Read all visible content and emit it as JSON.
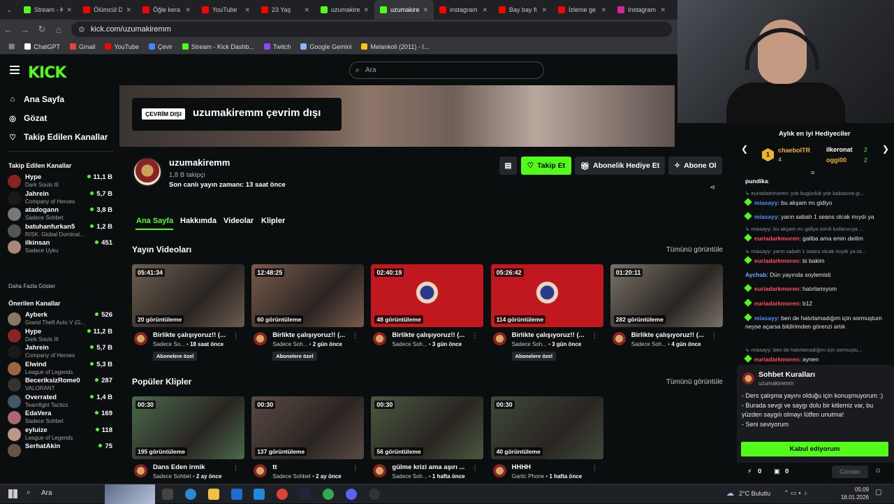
{
  "browser": {
    "tabs": [
      {
        "title": "Stream - K",
        "color": "#53fc18"
      },
      {
        "title": "Ölümcül D",
        "color": "#ff0000"
      },
      {
        "title": "Öğle kera",
        "color": "#ff0000"
      },
      {
        "title": "YouTube",
        "color": "#ff0000"
      },
      {
        "title": "23 Yaş",
        "color": "#ff0000"
      },
      {
        "title": "uzumakire",
        "color": "#53fc18"
      },
      {
        "title": "uzumakire",
        "color": "#53fc18"
      },
      {
        "title": "instagram",
        "color": "#ff0000"
      },
      {
        "title": "Bay bay fi",
        "color": "#ff0000"
      },
      {
        "title": "İzleme ge",
        "color": "#ff0000"
      },
      {
        "title": "Instagram",
        "color": "#d6249f"
      }
    ],
    "url": "kick.com/uzumakiremm",
    "bookmarks": [
      {
        "label": "ChatGPT",
        "color": "#ffffff"
      },
      {
        "label": "Gmail",
        "color": "#ea4335"
      },
      {
        "label": "YouTube",
        "color": "#ff0000"
      },
      {
        "label": "Çevir",
        "color": "#4285f4"
      },
      {
        "label": "Stream - Kick Dashb...",
        "color": "#53fc18"
      },
      {
        "label": "Twitch",
        "color": "#9146ff"
      },
      {
        "label": "Google Gemini",
        "color": "#8ab4f8"
      },
      {
        "label": "Melankoli (2011) - I...",
        "color": "#f5c518"
      }
    ]
  },
  "header": {
    "logo": "KICK",
    "search_placeholder": "Ara"
  },
  "sidebar": {
    "nav": [
      {
        "label": "Ana Sayfa",
        "icon": "home-icon"
      },
      {
        "label": "Gözat",
        "icon": "compass-icon"
      },
      {
        "label": "Takip Edilen Kanallar",
        "icon": "heart-icon"
      }
    ],
    "followed_title": "Takip Edilen Kanallar",
    "followed": [
      {
        "name": "Hype",
        "game": "Dark Souls III",
        "viewers": "11,1 B",
        "color": "#8b2323"
      },
      {
        "name": "Jahrein",
        "game": "Company of Heroes",
        "viewers": "5,7 B",
        "color": "#1a1a1a"
      },
      {
        "name": "atadogann",
        "game": "Sadece Sohbet",
        "viewers": "3,8 B",
        "color": "#777"
      },
      {
        "name": "batuhanfurkan5",
        "game": "RISK: Global Dominat...",
        "viewers": "1,2 B",
        "color": "#555"
      },
      {
        "name": "ilkinsan",
        "game": "Sadece Uyku",
        "viewers": "451",
        "color": "#aa8877"
      }
    ],
    "show_more": "Daha Fazla Göster",
    "recommended_title": "Önerilen Kanallar",
    "recommended": [
      {
        "name": "Ayberk",
        "game": "Grand Theft Auto V (G...",
        "viewers": "526",
        "color": "#887766"
      },
      {
        "name": "Hype",
        "game": "Dark Souls III",
        "viewers": "11,2 B",
        "color": "#8b2323"
      },
      {
        "name": "Jahrein",
        "game": "Company of Heroes",
        "viewers": "5,7 B",
        "color": "#1a1a1a"
      },
      {
        "name": "Elwind",
        "game": "League of Legends",
        "viewers": "5,3 B",
        "color": "#996644"
      },
      {
        "name": "BeceriksizRome0",
        "game": "VALORANT",
        "viewers": "287",
        "color": "#333"
      },
      {
        "name": "Overrated",
        "game": "Teamfight Tactics",
        "viewers": "1,4 B",
        "color": "#445566"
      },
      {
        "name": "EdaVera",
        "game": "Sadece Sohbet",
        "viewers": "169",
        "color": "#aa6677"
      },
      {
        "name": "eyluize",
        "game": "League of Legends",
        "viewers": "118",
        "color": "#bb9988"
      },
      {
        "name": "SerhatAkin",
        "game": "",
        "viewers": "75",
        "color": "#665544"
      }
    ]
  },
  "channel": {
    "offline_badge": "ÇEVRİM DIŞI",
    "offline_text": "uzumakiremm çevrim dışı",
    "name": "uzumakiremm",
    "followers": "1,8 B takipçi",
    "last_live": "Son canlı yayın zamanı: 13 saat önce",
    "buttons": {
      "follow": "Takip Et",
      "gift": "Abonelik Hediye Et",
      "subscribe": "Abone Ol"
    },
    "tabs": [
      "Ana Sayfa",
      "Hakkımda",
      "Videolar",
      "Klipler"
    ],
    "videos_title": "Yayın Videoları",
    "clips_title": "Popüler Klipler",
    "see_all": "Tümünü görüntüle",
    "videos": [
      {
        "duration": "05:41:34",
        "views": "20 görüntüleme",
        "title": "Birlikte çalışıyoruz!! (...",
        "category": "Sadece So...",
        "age": "18 saat önce",
        "badge": "Abonelere özel",
        "bg": "#6b5e50"
      },
      {
        "duration": "12:48:25",
        "views": "60 görüntüleme",
        "title": "Birlikte çalışıyoruz!! (...",
        "category": "Sadece Soh...",
        "age": "2 gün önce",
        "badge": "Abonelere özel",
        "bg": "#7a5a4a"
      },
      {
        "duration": "02:40:19",
        "views": "48 görüntüleme",
        "title": "Birlikte çalışıyoruz!! (...",
        "category": "Sadece Soh...",
        "age": "3 gün önce",
        "badge": "",
        "bg": "#c0181e"
      },
      {
        "duration": "05:26:42",
        "views": "114 görüntüleme",
        "title": "Birlikte çalışıyoruz!! (...",
        "category": "Sadece Soh...",
        "age": "3 gün önce",
        "badge": "Abonelere özel",
        "bg": "#c0181e"
      },
      {
        "duration": "01:20:11",
        "views": "282 görüntüleme",
        "title": "Birlikte çalışıyoruz!! (...",
        "category": "Sadece Soh...",
        "age": "4 gün önce",
        "badge": "",
        "bg": "#7a7268"
      }
    ],
    "clips": [
      {
        "duration": "00:30",
        "views": "195 görüntüleme",
        "title": "Dans Eden irmik",
        "category": "Sadece Sohbet",
        "age": "2 ay önce",
        "bg": "#4a6a4a"
      },
      {
        "duration": "00:30",
        "views": "137 görüntüleme",
        "title": "tt",
        "category": "Sadece Sohbet",
        "age": "2 ay önce",
        "bg": "#5a4a44"
      },
      {
        "duration": "00:30",
        "views": "56 görüntüleme",
        "title": "gülme krizi ama aşırı ...",
        "category": "Sadece Soh...",
        "age": "1 hafta önce",
        "bg": "#4a5a40"
      },
      {
        "duration": "00:30",
        "views": "40 görüntüleme",
        "title": "HHHH",
        "category": "Gartic Phone",
        "age": "1 hafta önce",
        "bg": "#3e4a3a"
      }
    ]
  },
  "chat": {
    "gifters_title": "Aylık en iyi Hediyeciler",
    "gifters": [
      {
        "name": "chaeboITR",
        "count": "4",
        "rank": "1"
      },
      {
        "name": "ilkeronat",
        "count": "2"
      },
      {
        "name": "oggi00",
        "count": "2"
      }
    ],
    "messages": [
      {
        "type": "msg",
        "user": "pundika",
        "text": ":",
        "color": "#ffffff",
        "badge": false
      },
      {
        "type": "reply",
        "text": "euriadarkmoren: yok bugünlük yok babasına gi..."
      },
      {
        "type": "msg",
        "user": "miasayy",
        "text": ": bu akşam mı gidiyo",
        "color": "#4c8dff",
        "badge": true
      },
      {
        "type": "msg",
        "user": "miasayy",
        "text": ": yarın sabah 1 seans olcak mıydı ya",
        "color": "#4c8dff",
        "badge": true
      },
      {
        "type": "reply",
        "text": "miasayy: bu akşam mı gidiyo isimli kullanıcıya ..."
      },
      {
        "type": "msg",
        "user": "euriadarkmoren",
        "text": ": galiba ama emin deilim",
        "color": "#ff4d5e",
        "badge": true
      },
      {
        "type": "reply",
        "text": "miasayy: yarın sabah 1 seans olcak mıydı ya isi..."
      },
      {
        "type": "msg",
        "user": "euriadarkmoren",
        "text": ": bi bakim",
        "color": "#ff4d5e",
        "badge": true
      },
      {
        "type": "msg",
        "user": "Aychab",
        "text": ": Dün yayında soylemisti",
        "color": "#6fa8ff",
        "badge": false
      },
      {
        "type": "msg",
        "user": "euriadarkmoren",
        "text": ": hatırlamıyom",
        "color": "#ff4d5e",
        "badge": true
      },
      {
        "type": "msg",
        "user": "euriadarkmoren",
        "text": ": b12",
        "color": "#ff4d5e",
        "badge": true
      },
      {
        "type": "msg",
        "user": "miasayy",
        "text": ": ben de hatırlamadığım için sormuştum neyse açarsa bildirimden görenzi artık",
        "color": "#4c8dff",
        "badge": true
      },
      {
        "type": "reply",
        "text": "miasayy: ben de hatırlamadığım için sormuştu..."
      },
      {
        "type": "msg",
        "user": "euriadarkmoren",
        "text": ": aynen",
        "color": "#ff4d5e",
        "badge": true
      }
    ],
    "rules_title": "Sohbet Kuralları",
    "rules_user": "uzumakiremm",
    "rules_text": "- Ders çalışma yayını olduğu için konuşmuyorum :)\n- Burada sevgi ve saygı dolu bir kitlemiz var, bu yüzden saygılı olmayı lütfen unutma!\n- Seni seviyorum",
    "accept": "Kabul ediyorum",
    "count1": "0",
    "count2": "0",
    "send": "Gönder"
  },
  "taskbar": {
    "search": "Ara",
    "weather": "2°C Bulutlu",
    "time": "05:09",
    "date": "18.01.2026"
  }
}
